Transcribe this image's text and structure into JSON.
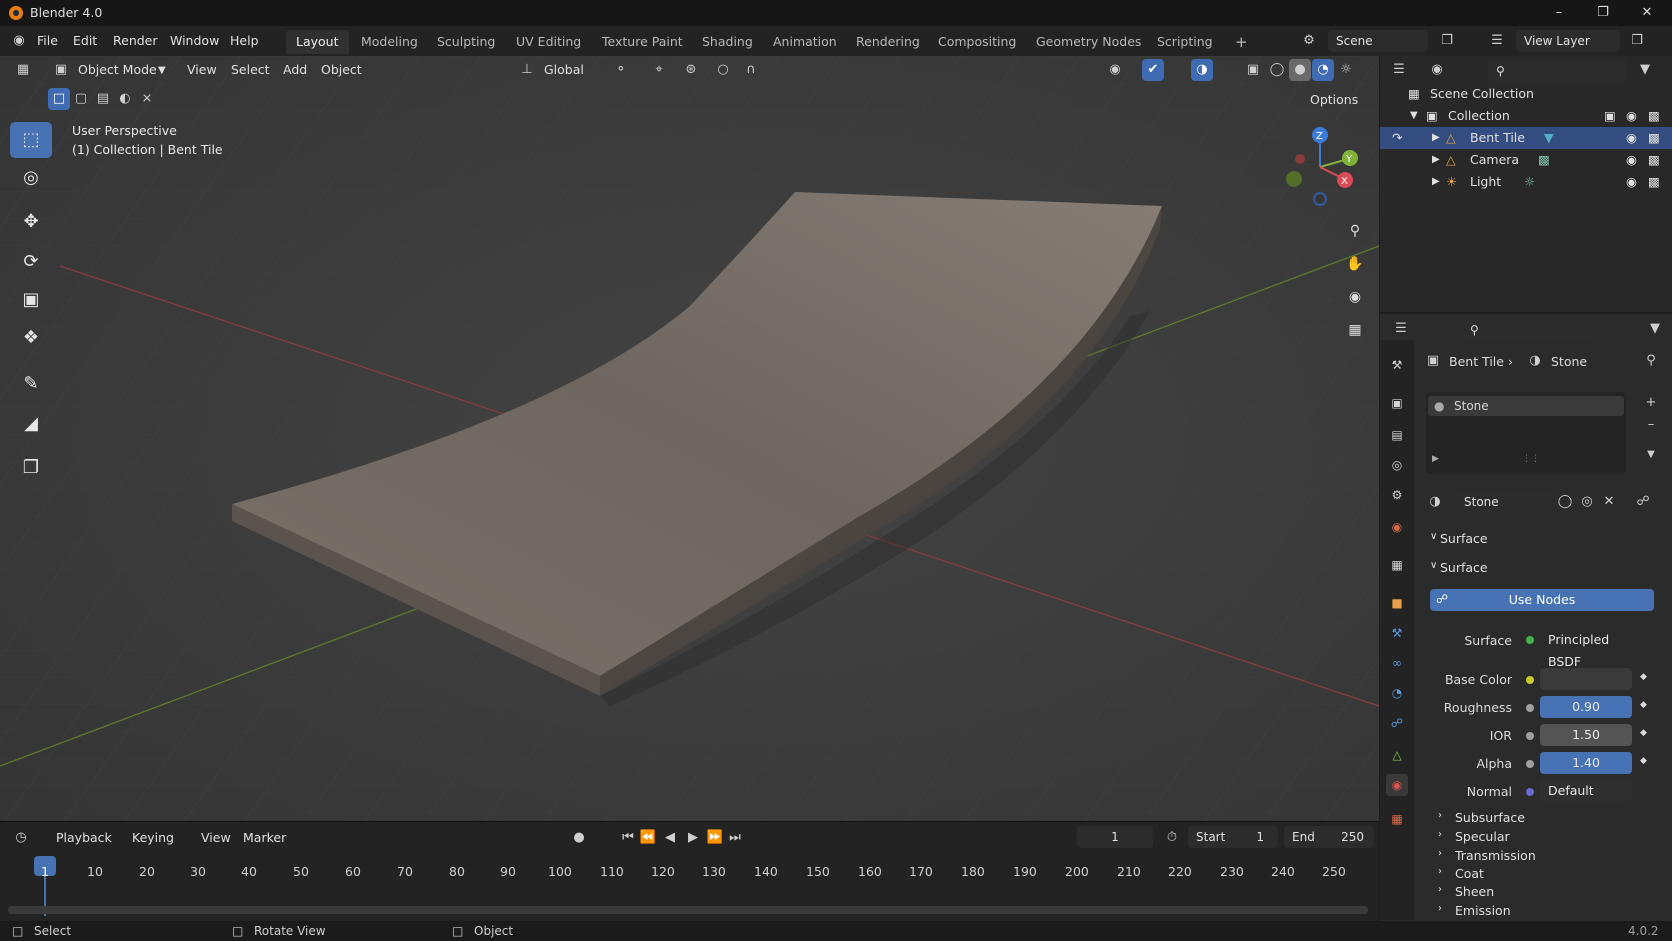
{
  "app": {
    "title": "Blender 4.0",
    "version": "4.0.2"
  },
  "menu": [
    "File",
    "Edit",
    "Render",
    "Window",
    "Help"
  ],
  "workspaces": [
    "Layout",
    "Modeling",
    "Sculpting",
    "UV Editing",
    "Texture Paint",
    "Shading",
    "Animation",
    "Rendering",
    "Compositing",
    "Geometry Nodes",
    "Scripting"
  ],
  "active_workspace": "Layout",
  "scene": "Scene",
  "view_layer": "View Layer",
  "viewport": {
    "mode": "Object Mode",
    "menus": [
      "View",
      "Select",
      "Add",
      "Object"
    ],
    "orientation": "Global",
    "options": "Options",
    "perspective": "User Perspective",
    "context": "(1) Collection | Bent Tile",
    "gizmo": {
      "z": "Z",
      "y": "Y",
      "x": "X"
    }
  },
  "outliner": {
    "scene_collection": "Scene Collection",
    "collection": "Collection",
    "items": [
      "Bent Tile",
      "Camera",
      "Light"
    ]
  },
  "properties": {
    "breadcrumb_object": "Bent Tile",
    "breadcrumb_material": "Stone",
    "slot": "Stone",
    "material": "Stone",
    "section1": "Surface",
    "section2": "Surface",
    "use_nodes": "Use Nodes",
    "surface_label": "Surface",
    "surface_value": "Principled BSDF",
    "fields": [
      {
        "label": "Base Color",
        "value": ""
      },
      {
        "label": "Roughness",
        "value": "0.90"
      },
      {
        "label": "IOR",
        "value": "1.50"
      },
      {
        "label": "Alpha",
        "value": "1.40"
      },
      {
        "label": "Normal",
        "value": "Default"
      }
    ],
    "subsections": [
      "Subsurface",
      "Specular",
      "Transmission",
      "Coat",
      "Sheen",
      "Emission"
    ]
  },
  "timeline": {
    "menus": [
      "Playback",
      "Keying",
      "View",
      "Marker"
    ],
    "current_frame": "1",
    "start_label": "Start",
    "start": "1",
    "end_label": "End",
    "end": "250",
    "ticks": [
      "1",
      "10",
      "20",
      "30",
      "40",
      "50",
      "60",
      "70",
      "80",
      "90",
      "100",
      "110",
      "120",
      "130",
      "140",
      "150",
      "160",
      "170",
      "180",
      "190",
      "200",
      "210",
      "220",
      "230",
      "240",
      "250"
    ]
  },
  "status": {
    "select": "Select",
    "rotate": "Rotate View",
    "object": "Object"
  },
  "colors": {
    "accent": "#4772b3",
    "selection": "#334d80",
    "background": "#3a3a3a"
  }
}
